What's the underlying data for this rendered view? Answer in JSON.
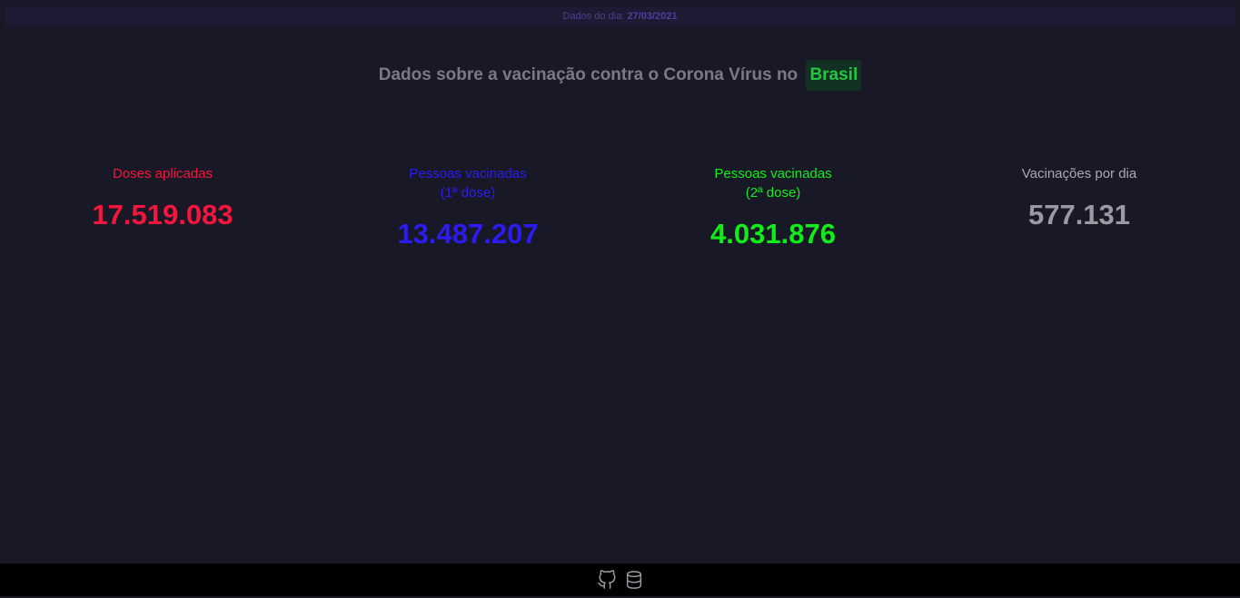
{
  "topbar": {
    "prefix": "Dados do dia: ",
    "date": "27/03/2021"
  },
  "headline": {
    "text": "Dados sobre a vacinação contra o Corona Vírus no",
    "country": "Brasil"
  },
  "stats": [
    {
      "label_line1": "Doses aplicadas",
      "label_line2": "",
      "value": "17.519.083",
      "color": "#f5163e"
    },
    {
      "label_line1": "Pessoas vacinadas",
      "label_line2": "(1ª dose)",
      "value": "13.487.207",
      "color": "#2b1cf2"
    },
    {
      "label_line1": "Pessoas vacinadas",
      "label_line2": "(2ª dose)",
      "value": "4.031.876",
      "color": "#10ee1a"
    },
    {
      "label_line1": "Vacinações por dia",
      "label_line2": "",
      "value": "577.131",
      "color": "#9a9aa3"
    }
  ],
  "footer": {
    "icons": [
      "github-icon",
      "database-icon"
    ]
  }
}
